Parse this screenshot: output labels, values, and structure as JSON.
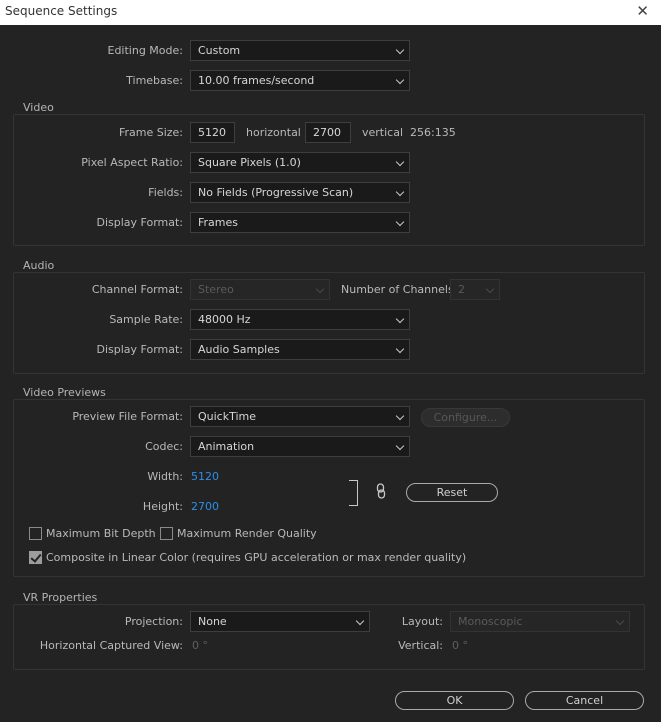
{
  "window": {
    "title": "Sequence Settings",
    "close_glyph": "✕"
  },
  "general": {
    "editing_mode_label": "Editing Mode:",
    "editing_mode_value": "Custom",
    "timebase_label": "Timebase:",
    "timebase_value": "10.00  frames/second"
  },
  "video": {
    "group_title": "Video",
    "frame_size_label": "Frame Size:",
    "frame_width": "5120",
    "horizontal_label": "horizontal",
    "frame_height": "2700",
    "vertical_label": "vertical",
    "aspect_ratio": "256:135",
    "pixel_aspect_label": "Pixel Aspect Ratio:",
    "pixel_aspect_value": "Square Pixels (1.0)",
    "fields_label": "Fields:",
    "fields_value": "No Fields (Progressive Scan)",
    "display_format_label": "Display Format:",
    "display_format_value": "Frames"
  },
  "audio": {
    "group_title": "Audio",
    "channel_format_label": "Channel Format:",
    "channel_format_value": "Stereo",
    "num_channels_label": "Number of Channels:",
    "num_channels_value": "2",
    "sample_rate_label": "Sample Rate:",
    "sample_rate_value": "48000 Hz",
    "display_format_label": "Display Format:",
    "display_format_value": "Audio Samples"
  },
  "previews": {
    "group_title": "Video Previews",
    "file_format_label": "Preview File Format:",
    "file_format_value": "QuickTime",
    "configure_label": "Configure...",
    "codec_label": "Codec:",
    "codec_value": "Animation",
    "width_label": "Width:",
    "width_value": "5120",
    "height_label": "Height:",
    "height_value": "2700",
    "reset_label": "Reset",
    "max_bit_depth_label": "Maximum Bit Depth",
    "max_render_quality_label": "Maximum Render Quality",
    "linear_color_label": "Composite in Linear Color (requires GPU acceleration or max render quality)"
  },
  "vr": {
    "group_title": "VR Properties",
    "projection_label": "Projection:",
    "projection_value": "None",
    "layout_label": "Layout:",
    "layout_value": "Monoscopic",
    "horiz_view_label": "Horizontal Captured View:",
    "horiz_view_value": "0 °",
    "vertical_label": "Vertical:",
    "vertical_value": "0 °"
  },
  "footer": {
    "ok_label": "OK",
    "cancel_label": "Cancel"
  }
}
